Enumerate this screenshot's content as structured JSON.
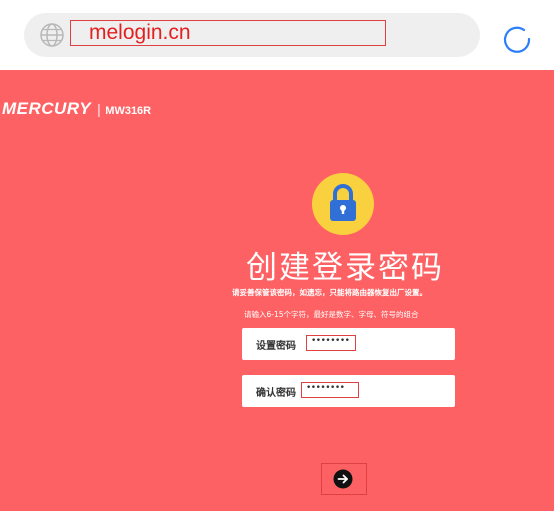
{
  "browser": {
    "url": "melogin.cn"
  },
  "router": {
    "brand": "MERCURY",
    "model": "MW316R",
    "title": "创建登录密码",
    "notice": "请妥善保管该密码，如遗忘，只能将路由器恢复出厂设置。",
    "hint": "请输入6-15个字符，最好是数字、字母、符号的组合",
    "set_password_label": "设置密码",
    "set_password_value": "••••••••",
    "confirm_password_label": "确认密码",
    "confirm_password_value": "••••••••"
  },
  "icons": {
    "globe": "globe-icon",
    "reload": "reload-icon",
    "lock": "lock-icon",
    "next": "arrow-right-icon"
  },
  "colors": {
    "page_background": "#fe6163",
    "lock_badge": "#f9d13e",
    "annotation_red": "#e04040"
  }
}
